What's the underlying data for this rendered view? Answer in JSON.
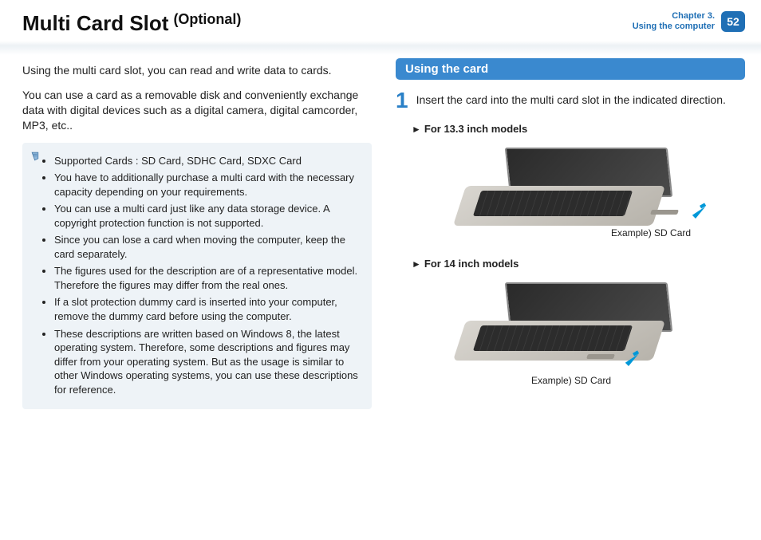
{
  "header": {
    "title": "Multi Card Slot",
    "subtitle": "(Optional)",
    "chapter_line1": "Chapter 3.",
    "chapter_line2": "Using the computer",
    "page_number": "52"
  },
  "intro": {
    "p1": "Using the multi card slot, you can read and write data to cards.",
    "p2": "You can use a card as a removable disk and conveniently exchange data with digital devices such as a digital camera, digital camcorder, MP3, etc.."
  },
  "notes": [
    "Supported Cards : SD Card, SDHC Card, SDXC Card",
    "You have to additionally purchase a multi card with the necessary capacity depending on your requirements.",
    "You can use a multi card just like any data storage device. A copyright protection function is not supported.",
    "Since you can lose a card when moving the computer, keep the card separately.",
    "The figures used for the description are of a representative model. Therefore the figures may differ from the real ones.",
    "If a slot protection dummy card is inserted into your computer, remove the dummy card before using the computer.",
    "These descriptions are written based on Windows 8, the latest operating system. Therefore, some descriptions and figures may differ from your operating system. But as the usage is similar to other Windows operating systems, you can use these descriptions for reference."
  ],
  "right": {
    "section_title": "Using the card",
    "step1_num": "1",
    "step1_text": "Insert the card into the multi card slot in the indicated direction.",
    "model13": "For 13.3 inch models",
    "model14": "For 14 inch models",
    "caption13": "Example) SD Card",
    "caption14": "Example) SD Card"
  }
}
